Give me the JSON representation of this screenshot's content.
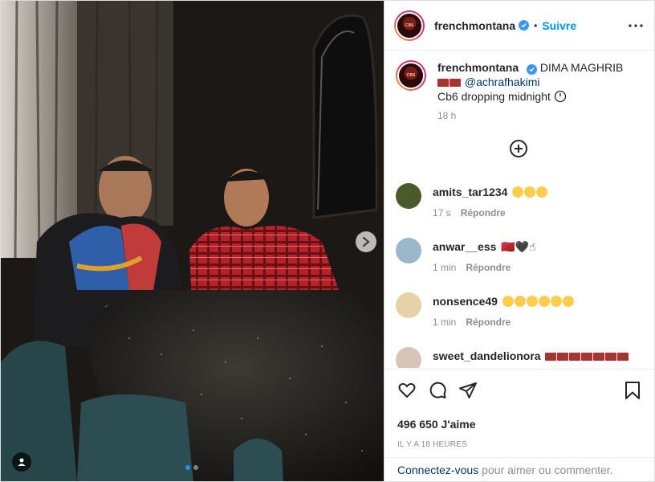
{
  "post": {
    "username": "frenchmontana",
    "follow_label": "Suivre",
    "separator": "•",
    "caption": {
      "title": "DIMA MAGHRIB",
      "mention": "@achrafhakimi",
      "line2": "Cb6 dropping midnight",
      "time": "18 h"
    },
    "likes": "496 650 J'aime",
    "date": "IL Y A 18 HEURES"
  },
  "comments": [
    {
      "user": "amits_tar1234",
      "text": "",
      "time": "17 s",
      "reply": "Répondre",
      "avatar_color": "#4a5a2a",
      "emoji_count": 3
    },
    {
      "user": "anwar__ess",
      "text": "🇲🇦🖤☝",
      "time": "1 min",
      "reply": "Répondre",
      "avatar_color": "#9bb7cc",
      "emoji_count": 0
    },
    {
      "user": "nonsence49",
      "text": "",
      "time": "1 min",
      "reply": "Répondre",
      "avatar_color": "#e7d2a8",
      "emoji_count": 6
    },
    {
      "user": "sweet_dandelionora",
      "text": "",
      "time": "",
      "reply": "",
      "avatar_color": "#d8c4b8",
      "emoji_count": 0
    }
  ],
  "login_bar": {
    "link": "Connectez-vous",
    "rest": "pour aimer ou commenter."
  },
  "icons": {
    "more": "more-icon",
    "load_more": "plus-circle-icon",
    "like": "heart-icon",
    "comment": "comment-icon",
    "share": "share-icon",
    "save": "bookmark-icon",
    "next": "chevron-right-icon",
    "tag": "user-tag-icon"
  },
  "colors": {
    "accent": "#0095f6",
    "verified": "#3897f0",
    "muted": "#8e8e8e",
    "link": "#00376b"
  }
}
